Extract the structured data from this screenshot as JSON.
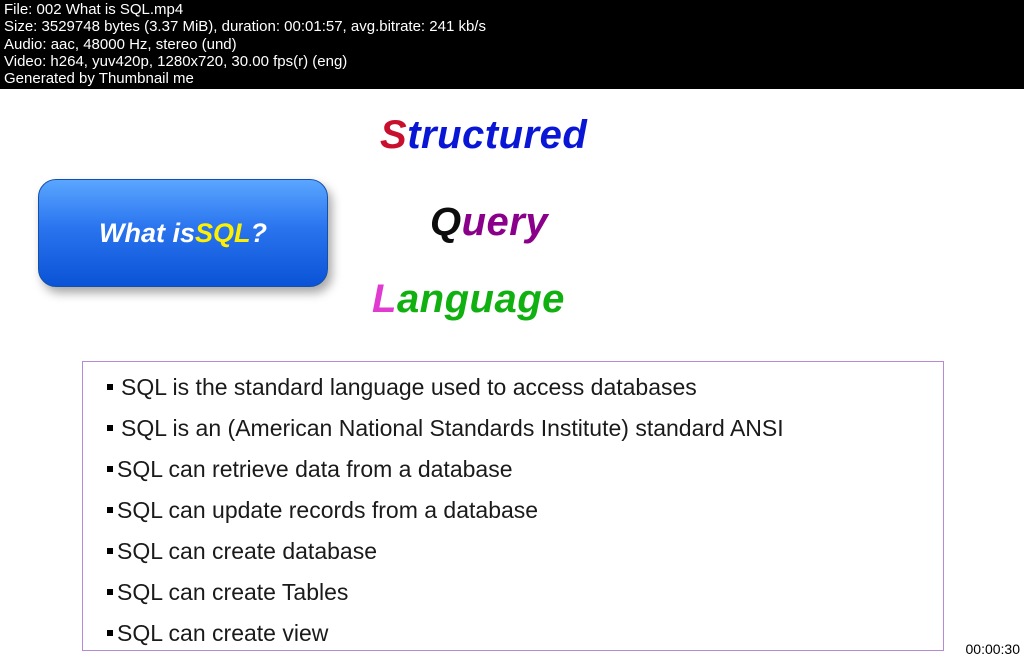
{
  "meta": {
    "line1": "File: 002 What is SQL.mp4",
    "line2": "Size: 3529748 bytes (3.37 MiB), duration: 00:01:57, avg.bitrate: 241 kb/s",
    "line3": "Audio: aac, 48000 Hz, stereo (und)",
    "line4": "Video: h264, yuv420p, 1280x720, 30.00 fps(r) (eng)",
    "line5": "Generated by Thumbnail me"
  },
  "title": {
    "w1_first": "S",
    "w1_rest": "tructured",
    "w2_first": "Q",
    "w2_rest": "uery",
    "w3_first": "L",
    "w3_rest": "anguage"
  },
  "button": {
    "prefix": "What is ",
    "sql": "SQL",
    "suffix": " ?"
  },
  "bullets": [
    " SQL is the standard language used to access databases",
    " SQL is  an (American National Standards Institute) standard ANSI",
    "SQL can retrieve data from a database",
    "SQL can update records from a database",
    "SQL can create database",
    "SQL can create Tables",
    "SQL can create view"
  ],
  "timestamp": "00:00:30"
}
